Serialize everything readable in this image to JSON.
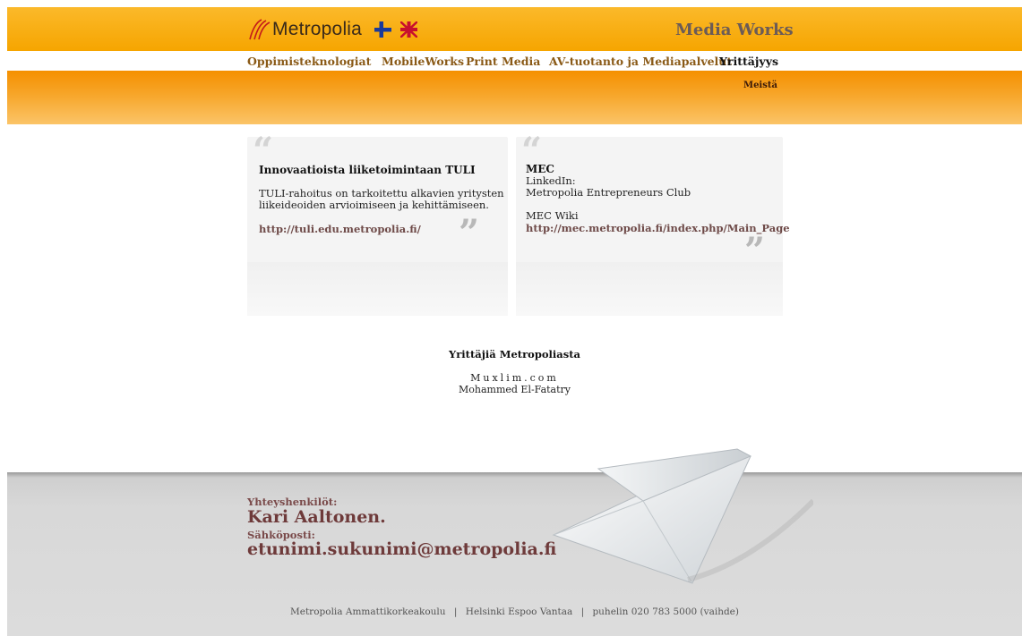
{
  "header": {
    "logo_text": "Metropolia",
    "site_name": "Media Works",
    "flags": [
      "finnish-flag-icon",
      "uk-flag-icon"
    ],
    "colors": {
      "header_bg": "#f6a500",
      "accent_link": "#8a5a17",
      "footer_text": "#6e3a3a"
    }
  },
  "nav": {
    "items": [
      {
        "label": "Oppimisteknologiat"
      },
      {
        "label": "MobileWorks"
      },
      {
        "label": "Print Media"
      },
      {
        "label": "AV-tuotanto ja Mediapalvelut"
      },
      {
        "label": "Yrittäjyys",
        "active": true
      }
    ],
    "sub_items": [
      {
        "label": "Meistä"
      }
    ]
  },
  "boxes": [
    {
      "title": "Innovaatioista liiketoimintaan TULI",
      "text_line1": "TULI-rahoitus on tarkoitettu alkavien yritysten",
      "text_line2": "liikeideoiden arvioimiseen ja kehittämiseen.",
      "link": "http://tuli.edu.metropolia.fi/"
    },
    {
      "title": "MEC",
      "line1": "LinkedIn:",
      "line2": "Metropolia Entrepreneurs Club",
      "line3": "MEC Wiki",
      "link": "http://mec.metropolia.fi/index.php/Main_Page"
    }
  ],
  "entrepreneurs": {
    "heading": "Yrittäjiä Metropoliasta",
    "items": [
      "Muxlim.com",
      "Mohammed El-Fatatry"
    ]
  },
  "footer": {
    "contacts_label": "Yhteyshenkilöt:",
    "contact_name": "Kari Aaltonen.",
    "email_label": "Sähköposti:",
    "email": "etunimi.sukunimi@metropolia.fi",
    "org": "Metropolia Ammattikorkeakoulu",
    "sep1": "|",
    "cities": "Helsinki  Espoo  Vantaa",
    "sep2": "|",
    "phone": "puhelin 020 783 5000  (vaihde)"
  }
}
